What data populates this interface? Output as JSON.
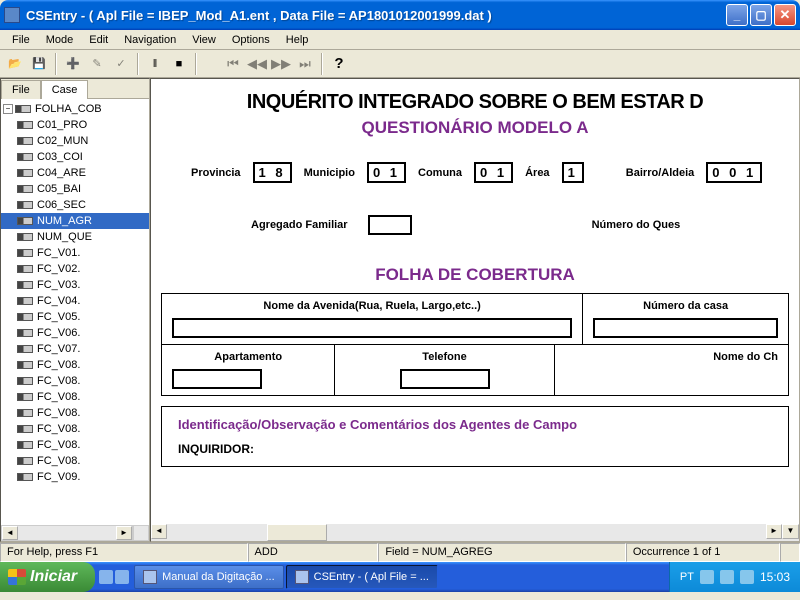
{
  "window": {
    "title": "CSEntry - ( Apl File = IBEP_Mod_A1.ent , Data File = AP1801012001999.dat )"
  },
  "menu": {
    "items": [
      "File",
      "Mode",
      "Edit",
      "Navigation",
      "View",
      "Options",
      "Help"
    ]
  },
  "tree": {
    "tabs": [
      "File",
      "Case"
    ],
    "root": "FOLHA_COB",
    "items": [
      "C01_PRO",
      "C02_MUN",
      "C03_COI",
      "C04_ARE",
      "C05_BAI",
      "C06_SEC",
      "NUM_AGR",
      "NUM_QUE",
      "FC_V01.",
      "FC_V02.",
      "FC_V03.",
      "FC_V04.",
      "FC_V05.",
      "FC_V06.",
      "FC_V07.",
      "FC_V08.",
      "FC_V08.",
      "FC_V08.",
      "FC_V08.",
      "FC_V08.",
      "FC_V08.",
      "FC_V08.",
      "FC_V09."
    ]
  },
  "form": {
    "title": "INQUÉRITO INTEGRADO SOBRE O BEM ESTAR D",
    "subtitle": "QUESTIONÁRIO MODELO A",
    "loc": {
      "provincia_label": "Provincia",
      "provincia": "1 8",
      "municipio_label": "Municipio",
      "municipio": "0 1",
      "comuna_label": "Comuna",
      "comuna": "0 1",
      "area_label": "Área",
      "area": "1",
      "bairro_label": "Bairro/Aldeia",
      "bairro": "0 0 1"
    },
    "agregado_label": "Agregado Familiar",
    "numques_label": "Número do Ques",
    "section": "FOLHA DE COBERTURA",
    "fields": {
      "avenida": "Nome da Avenida(Rua, Ruela, Largo,etc..)",
      "numcasa": "Número da casa",
      "apto": "Apartamento",
      "tel": "Telefone",
      "nomech": "Nome do Ch"
    },
    "comments_head": "Identificação/Observação e Comentários dos Agentes de Campo",
    "inquiridor": "INQUIRIDOR:"
  },
  "status": {
    "help": "For Help, press F1",
    "add": "ADD",
    "field": "Field = NUM_AGREG",
    "occ": "Occurrence 1 of 1"
  },
  "taskbar": {
    "start": "Iniciar",
    "items": [
      "Manual da Digitação ...",
      "CSEntry - ( Apl File = ..."
    ],
    "lang": "PT",
    "clock": "15:03"
  }
}
